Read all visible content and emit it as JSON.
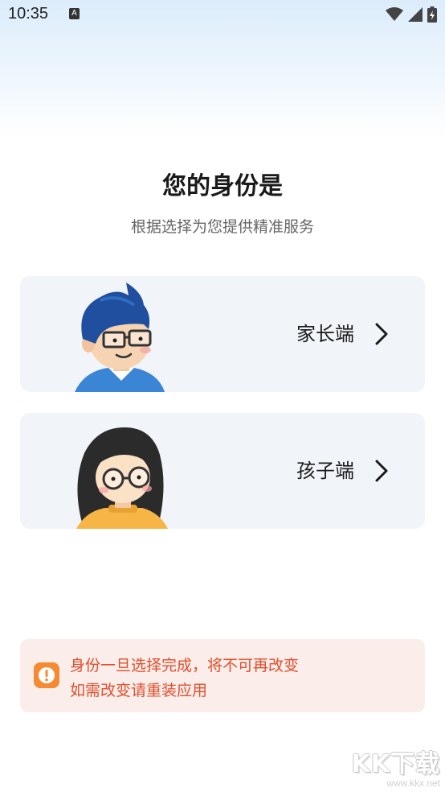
{
  "status_bar": {
    "time": "10:35",
    "notification_letter": "A",
    "icons": [
      "wifi-icon",
      "cellular-signal-icon",
      "battery-charging-icon"
    ]
  },
  "header": {
    "title": "您的身份是",
    "subtitle": "根据选择为您提供精准服务"
  },
  "roles": [
    {
      "label": "家长端",
      "avatar": "parent-avatar",
      "chevron": "chevron-right-icon"
    },
    {
      "label": "孩子端",
      "avatar": "child-avatar",
      "chevron": "chevron-right-icon"
    }
  ],
  "notice": {
    "icon": "warning-icon",
    "line1": "身份一旦选择完成，将不可再改变",
    "line2": "如需改变请重装应用",
    "color": "#e24d2c",
    "background": "#fbeeea"
  },
  "watermark": {
    "logo_text": "KK下载",
    "url": "www.kkx.net"
  },
  "colors": {
    "card_background": "#f1f5f9",
    "title": "#1a1a1a",
    "subtitle": "#666666"
  }
}
